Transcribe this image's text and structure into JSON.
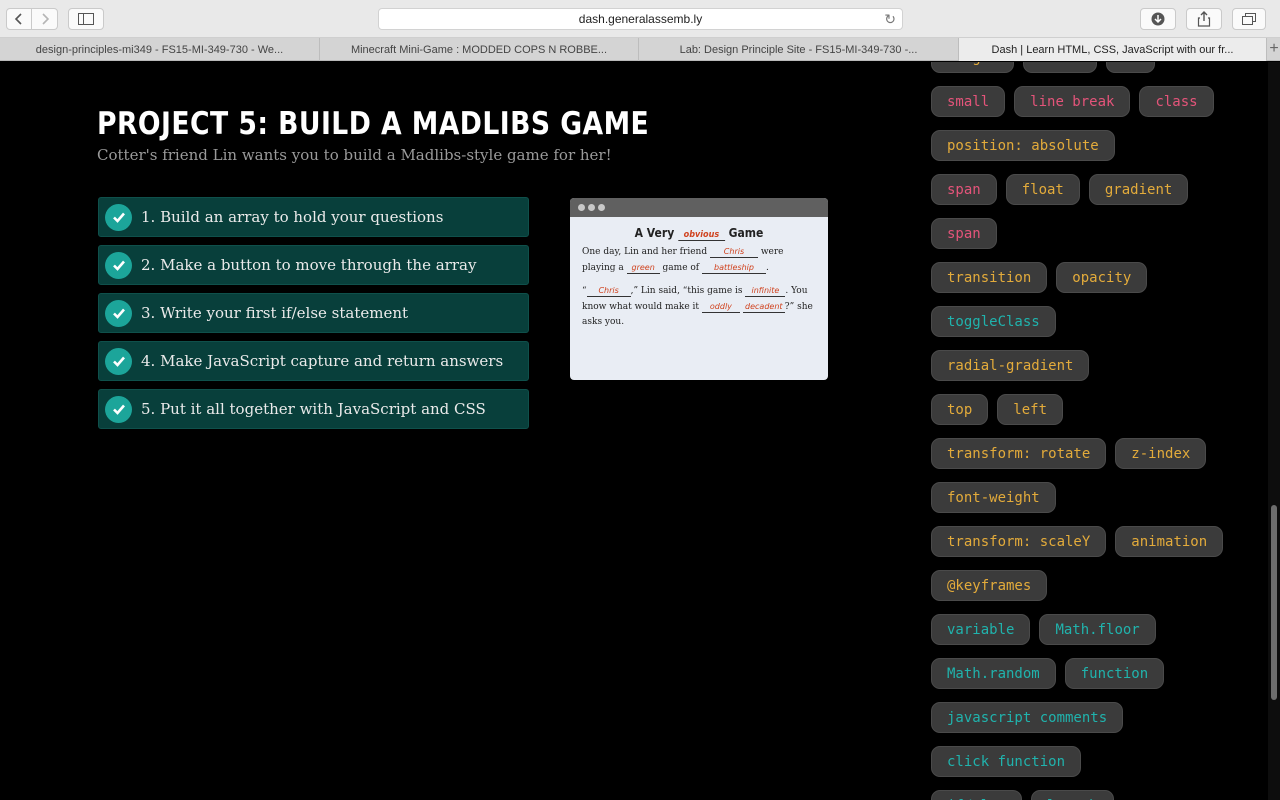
{
  "browser": {
    "url": "dash.generalassemb.ly",
    "tabs": [
      {
        "label": "design-principles-mi349 - FS15-MI-349-730 - We..."
      },
      {
        "label": "Minecraft Mini-Game : MODDED COPS N ROBBE..."
      },
      {
        "label": "Lab: Design Principle Site - FS15-MI-349-730 -..."
      },
      {
        "label": "Dash | Learn HTML, CSS, JavaScript with our fr..."
      }
    ],
    "new_tab": "+"
  },
  "project": {
    "title": "PROJECT 5: BUILD A MADLIBS GAME",
    "subtitle": "Cotter's friend Lin wants you to build a Madlibs-style game for her!",
    "steps": [
      {
        "label": "1. Build an array to hold your questions"
      },
      {
        "label": "2. Make a button to move through the array"
      },
      {
        "label": "3. Write your first if/else statement"
      },
      {
        "label": "4. Make JavaScript capture and return answers"
      },
      {
        "label": "5. Put it all together with JavaScript and CSS"
      }
    ]
  },
  "preview": {
    "title_a": "A Very",
    "title_blank": "obvious",
    "title_b": "Game",
    "line1_a": "One day, Lin and her friend",
    "line1_blank1": "Chris",
    "line1_b": "were playing",
    "line1_c": "a",
    "line1_blank2": "green",
    "line1_d": "game of",
    "line1_blank3": "battleship",
    "line1_e": ".",
    "line2_a": "“",
    "line2_blank1": "Chris",
    "line2_b": ",” Lin said, “this game is",
    "line2_blank2": "infinite",
    "line2_c": ". You",
    "line2_d": "know what would make it",
    "line2_blank3": "oddly",
    "line2_blank4": "decadent",
    "line2_e": "?”",
    "line2_f": "she asks you."
  },
  "tags": {
    "rows": [
      [
        {
          "label": "height",
          "color": "orange"
        },
        {
          "label": "width",
          "color": "orange"
        },
        {
          "label": "id",
          "color": "red"
        }
      ],
      [
        {
          "label": "small",
          "color": "red"
        },
        {
          "label": "line break",
          "color": "red"
        },
        {
          "label": "class",
          "color": "red"
        }
      ],
      [
        {
          "label": "position: absolute",
          "color": "orange"
        }
      ],
      [
        {
          "label": "span",
          "color": "red"
        },
        {
          "label": "float",
          "color": "orange"
        },
        {
          "label": "gradient",
          "color": "orange"
        }
      ],
      [
        {
          "label": "span",
          "color": "red"
        }
      ],
      [
        {
          "label": "transition",
          "color": "orange"
        },
        {
          "label": "opacity",
          "color": "orange"
        }
      ],
      [
        {
          "label": "toggleClass",
          "color": "teal"
        }
      ],
      [
        {
          "label": "radial-gradient",
          "color": "orange"
        }
      ],
      [
        {
          "label": "top",
          "color": "orange"
        },
        {
          "label": "left",
          "color": "orange"
        }
      ],
      [
        {
          "label": "transform: rotate",
          "color": "orange"
        },
        {
          "label": "z-index",
          "color": "orange"
        }
      ],
      [
        {
          "label": "font-weight",
          "color": "orange"
        }
      ],
      [
        {
          "label": "transform: scaleY",
          "color": "orange"
        },
        {
          "label": "animation",
          "color": "orange"
        }
      ],
      [
        {
          "label": "@keyframes",
          "color": "orange"
        }
      ],
      [
        {
          "label": "variable",
          "color": "teal"
        },
        {
          "label": "Math.floor",
          "color": "teal"
        }
      ],
      [
        {
          "label": "Math.random",
          "color": "teal"
        },
        {
          "label": "function",
          "color": "teal"
        }
      ],
      [
        {
          "label": "javascript comments",
          "color": "teal"
        }
      ],
      [
        {
          "label": "click function",
          "color": "teal"
        }
      ],
      [
        {
          "label": "if/else",
          "color": "teal"
        },
        {
          "label": "length",
          "color": "teal"
        }
      ]
    ]
  },
  "colors": {
    "step_bg": "#083f3b",
    "check": "#1ca59a",
    "tag_red": "#e4547a",
    "tag_orange": "#e3ab3b",
    "tag_teal": "#20b3ad"
  }
}
